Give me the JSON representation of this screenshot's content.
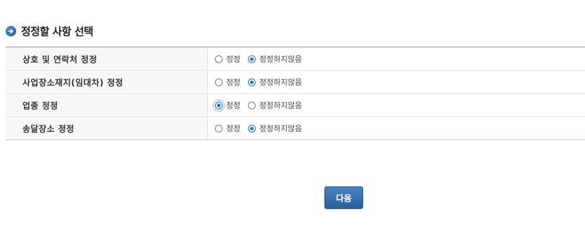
{
  "section": {
    "title": "정정할 사항 선택",
    "icon": "arrow-right-circle-icon"
  },
  "rows": [
    {
      "label": "상호 및 연락처 정정",
      "options": [
        {
          "label": "정정",
          "checked": false
        },
        {
          "label": "정정하지않음",
          "checked": true
        }
      ]
    },
    {
      "label": "사업장소재지(임대차) 정정",
      "options": [
        {
          "label": "정정",
          "checked": false
        },
        {
          "label": "정정하지않음",
          "checked": true
        }
      ]
    },
    {
      "label": "업종 정정",
      "options": [
        {
          "label": "정정",
          "checked": true,
          "focused": true
        },
        {
          "label": "정정하지않음",
          "checked": false
        }
      ]
    },
    {
      "label": "송달장소 정정",
      "options": [
        {
          "label": "정정",
          "checked": false
        },
        {
          "label": "정정하지않음",
          "checked": true
        }
      ]
    }
  ],
  "buttons": {
    "next_label": "다음"
  },
  "colors": {
    "accent": "#1a6fd6",
    "button": "#2f6aad"
  }
}
